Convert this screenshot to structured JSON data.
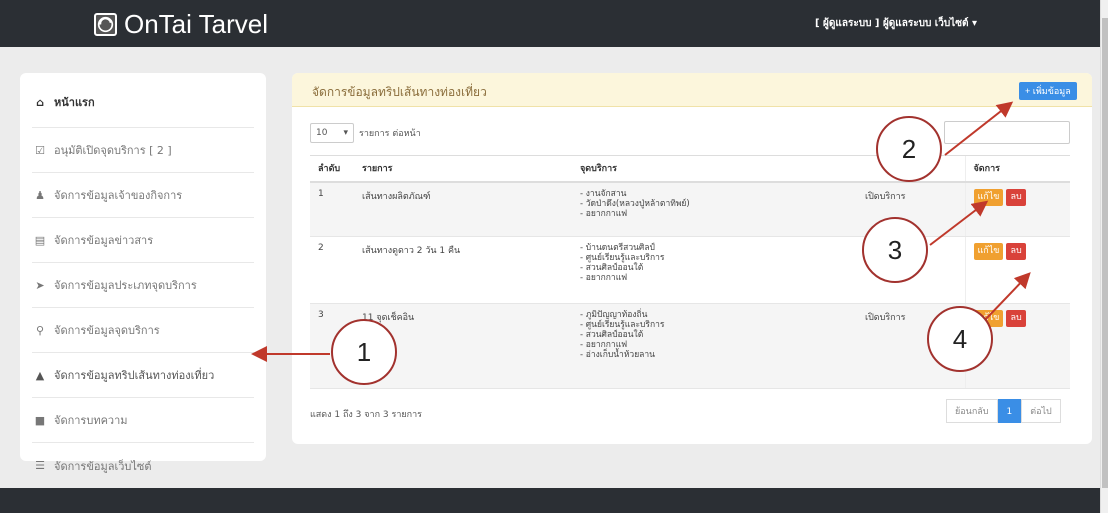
{
  "header": {
    "brand": "OnTai Tarvel",
    "user_menu": "[ ผู้ดูแลระบบ ] ผู้ดูแลระบบ เว็บไซต์ ▾"
  },
  "sidebar": {
    "items": [
      {
        "label": "หน้าแรก",
        "icon": "home-icon"
      },
      {
        "label": "อนุมัติเปิดจุดบริการ [ 2 ]",
        "icon": "check-square-icon"
      },
      {
        "label": "จัดการข้อมูลเจ้าของกิจการ",
        "icon": "user-icon"
      },
      {
        "label": "จัดการข้อมูลข่าวสาร",
        "icon": "news-icon"
      },
      {
        "label": "จัดการข้อมูลประเภทจุดบริการ",
        "icon": "tag-icon"
      },
      {
        "label": "จัดการข้อมูลจุดบริการ",
        "icon": "map-marker-icon"
      },
      {
        "label": "จัดการข้อมูลทริปเส้นทางท่องเที่ยว",
        "icon": "road-icon"
      },
      {
        "label": "จัดการบทความ",
        "icon": "book-icon"
      },
      {
        "label": "จัดการข้อมูลเว็บไซต์",
        "icon": "list-icon"
      }
    ]
  },
  "panel": {
    "title": "จัดการข้อมูลทริปเส้นทางท่องเที่ยว",
    "add_button": "+ เพิ่มข้อมูล",
    "page_length": "10",
    "page_length_label": "รายการ ต่อหน้า",
    "columns": [
      "ลำดับ",
      "รายการ",
      "จุดบริการ",
      "",
      "จัดการ"
    ],
    "rows": [
      {
        "no": "1",
        "name": "เส้นทางผลิตภัณฑ์",
        "points": [
          "- งานจักสาน",
          "- วัดป่าดึง(หลวงปู่หล้าตาทิพย์)",
          "- อยากกาแฟ"
        ],
        "status": "เปิดบริการ"
      },
      {
        "no": "2",
        "name": "เส้นทางดูดาว 2 วัน 1 คืน",
        "points": [
          "- บ้านดนตรีสวนศิลป์",
          "- ศูนย์เรียนรู้และบริการ",
          "- สวนศิลป์ออนใต้",
          "- อยากกาแฟ"
        ],
        "status": ""
      },
      {
        "no": "3",
        "name": "11 จุดเช็คอิน",
        "points": [
          "- ภูมิปัญญาท้องถิ่น",
          "- ศูนย์เรียนรู้และบริการ",
          "- สวนศิลป์ออนใต้",
          "- อยากกาแฟ",
          "- อ่างเก็บน้ำห้วยลาน"
        ],
        "status": "เปิดบริการ"
      }
    ],
    "edit_label": "แก้ไข",
    "delete_label": "ลบ",
    "info": "แสดง 1 ถึง 3 จาก 3 รายการ",
    "pager": {
      "prev": "ย้อนกลับ",
      "current": "1",
      "next": "ต่อไป"
    }
  },
  "callouts": [
    "1",
    "2",
    "3",
    "4"
  ],
  "colors": {
    "callout_border": "#a2322e",
    "primary": "#3a8ee6",
    "edit": "#f0a030",
    "delete": "#d9423a"
  }
}
